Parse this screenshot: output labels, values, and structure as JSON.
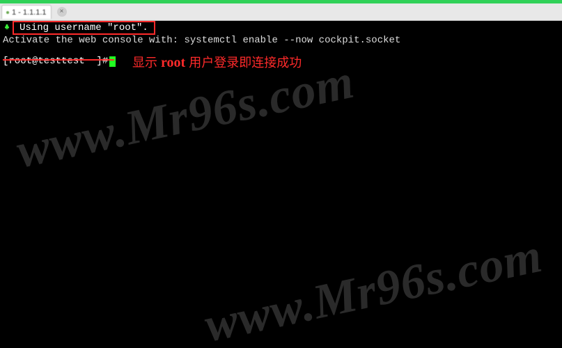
{
  "topbar": {},
  "tab": {
    "label": "1 - 1.1.1.1",
    "icon": "session-dot-icon",
    "close_label": "×"
  },
  "terminal": {
    "paw_glyph": "♣",
    "line1": "Using username \"root\".",
    "line2": "Activate the web console with: systemctl enable --now cockpit.socket",
    "prompt": "[root@testtest ~]#",
    "cursor_glyph": " "
  },
  "annotation": {
    "prefix": "显示 ",
    "bold": "root",
    "suffix": " 用户登录即连接成功"
  },
  "watermark": {
    "text": "www.Mr96s.com"
  }
}
